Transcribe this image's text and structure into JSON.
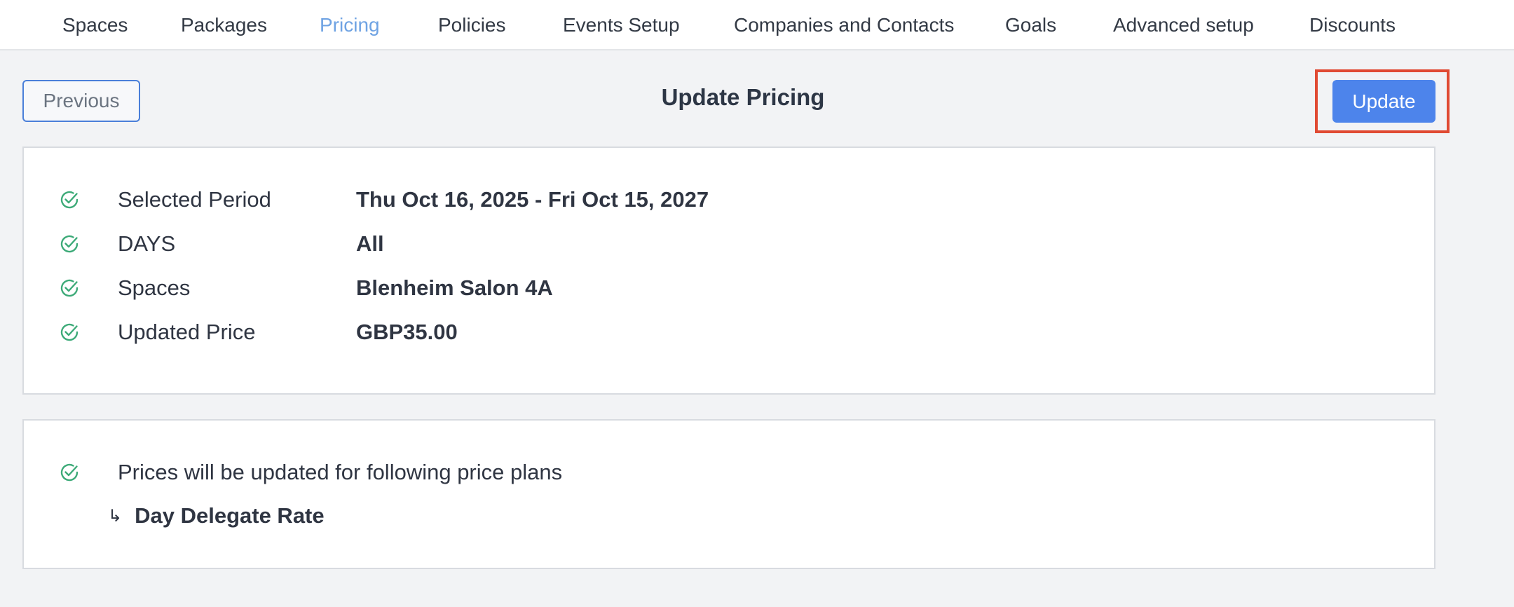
{
  "nav": {
    "items": [
      {
        "label": "Spaces",
        "active": false
      },
      {
        "label": "Packages",
        "active": false
      },
      {
        "label": "Pricing",
        "active": true
      },
      {
        "label": "Policies",
        "active": false
      },
      {
        "label": "Events Setup",
        "active": false
      },
      {
        "label": "Companies and Contacts",
        "active": false
      },
      {
        "label": "Goals",
        "active": false
      },
      {
        "label": "Advanced setup",
        "active": false
      },
      {
        "label": "Discounts",
        "active": false
      }
    ]
  },
  "header": {
    "previous_label": "Previous",
    "title": "Update Pricing",
    "update_label": "Update"
  },
  "summary": {
    "rows": [
      {
        "label": "Selected Period",
        "value": "Thu Oct 16, 2025 - Fri Oct 15, 2027",
        "icon": "check-circle-icon"
      },
      {
        "label": "DAYS",
        "value": "All",
        "icon": "check-circle-icon"
      },
      {
        "label": "Spaces",
        "value": "Blenheim Salon 4A",
        "icon": "check-circle-icon"
      },
      {
        "label": "Updated Price",
        "value": "GBP35.00",
        "icon": "check-circle-icon"
      }
    ]
  },
  "price_plans": {
    "message": "Prices will be updated for following price plans",
    "arrow_glyph": "↳",
    "plans": [
      "Day Delegate Rate"
    ]
  },
  "colors": {
    "accent": "#4d84eb",
    "nav_active": "#6fa3e3",
    "check": "#3daa78",
    "highlight": "#e04a33"
  }
}
